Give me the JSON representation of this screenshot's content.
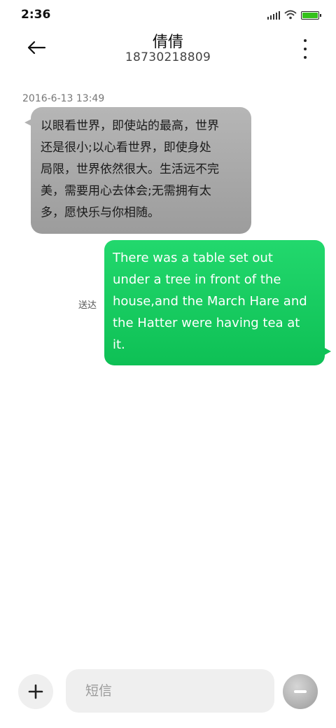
{
  "status_bar": {
    "time": "2:36",
    "icons": [
      "signal-icon",
      "wifi-icon",
      "battery-icon"
    ],
    "battery_color": "#34c21b"
  },
  "header": {
    "contact_name": "倩倩",
    "contact_number": "18730218809",
    "back_icon": "arrow-left-icon",
    "more_icon": "more-vertical-icon"
  },
  "messages": [
    {
      "direction": "incoming",
      "timestamp": "2016-6-13 13:49",
      "lines": [
        "以眼看世界，即使站的最高，世界",
        "还是很小;以心看世界，即使身处",
        "局限，世界依然很大。生活远不完",
        "美，需要用心去体会;无需拥有太",
        "多，愿快乐与你相随。"
      ]
    },
    {
      "direction": "outgoing",
      "status": "送达",
      "lines": [
        "There was a table set out",
        "under a tree in front of the",
        "house,and the March Hare and",
        "the Hatter were having tea at",
        "it."
      ]
    }
  ],
  "input_bar": {
    "placeholder": "短信",
    "add_icon": "plus-icon",
    "send_icon": "send-icon",
    "outgoing_color": "#12c75d"
  }
}
